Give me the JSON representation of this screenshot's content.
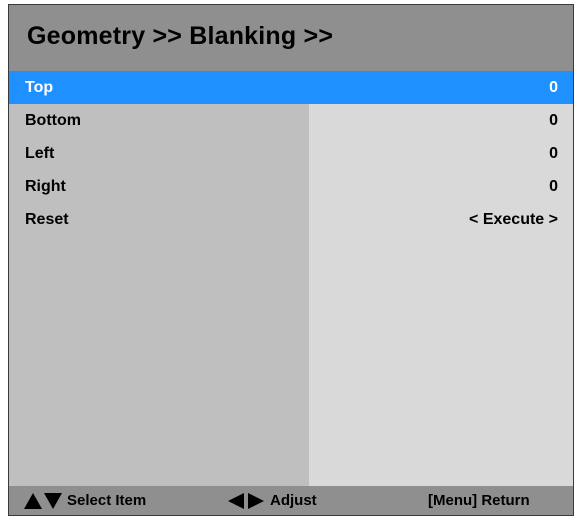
{
  "header": {
    "title": "Geometry >> Blanking >>"
  },
  "menu": {
    "items": [
      {
        "label": "Top",
        "value": "0"
      },
      {
        "label": "Bottom",
        "value": "0"
      },
      {
        "label": "Left",
        "value": "0"
      },
      {
        "label": "Right",
        "value": "0"
      },
      {
        "label": "Reset",
        "value": "< Execute >"
      }
    ],
    "selected_index": 0
  },
  "footer": {
    "select_label": "Select Item",
    "adjust_label": "Adjust",
    "return_label": "[Menu] Return"
  },
  "icons": {
    "select": "up-down-triangle-icon",
    "adjust": "left-right-triangle-icon"
  },
  "colors": {
    "selection": "#1e90ff",
    "title_bar": "#8f8f8f",
    "left_column": "#bfbfbf",
    "right_column": "#d9d9d9"
  }
}
